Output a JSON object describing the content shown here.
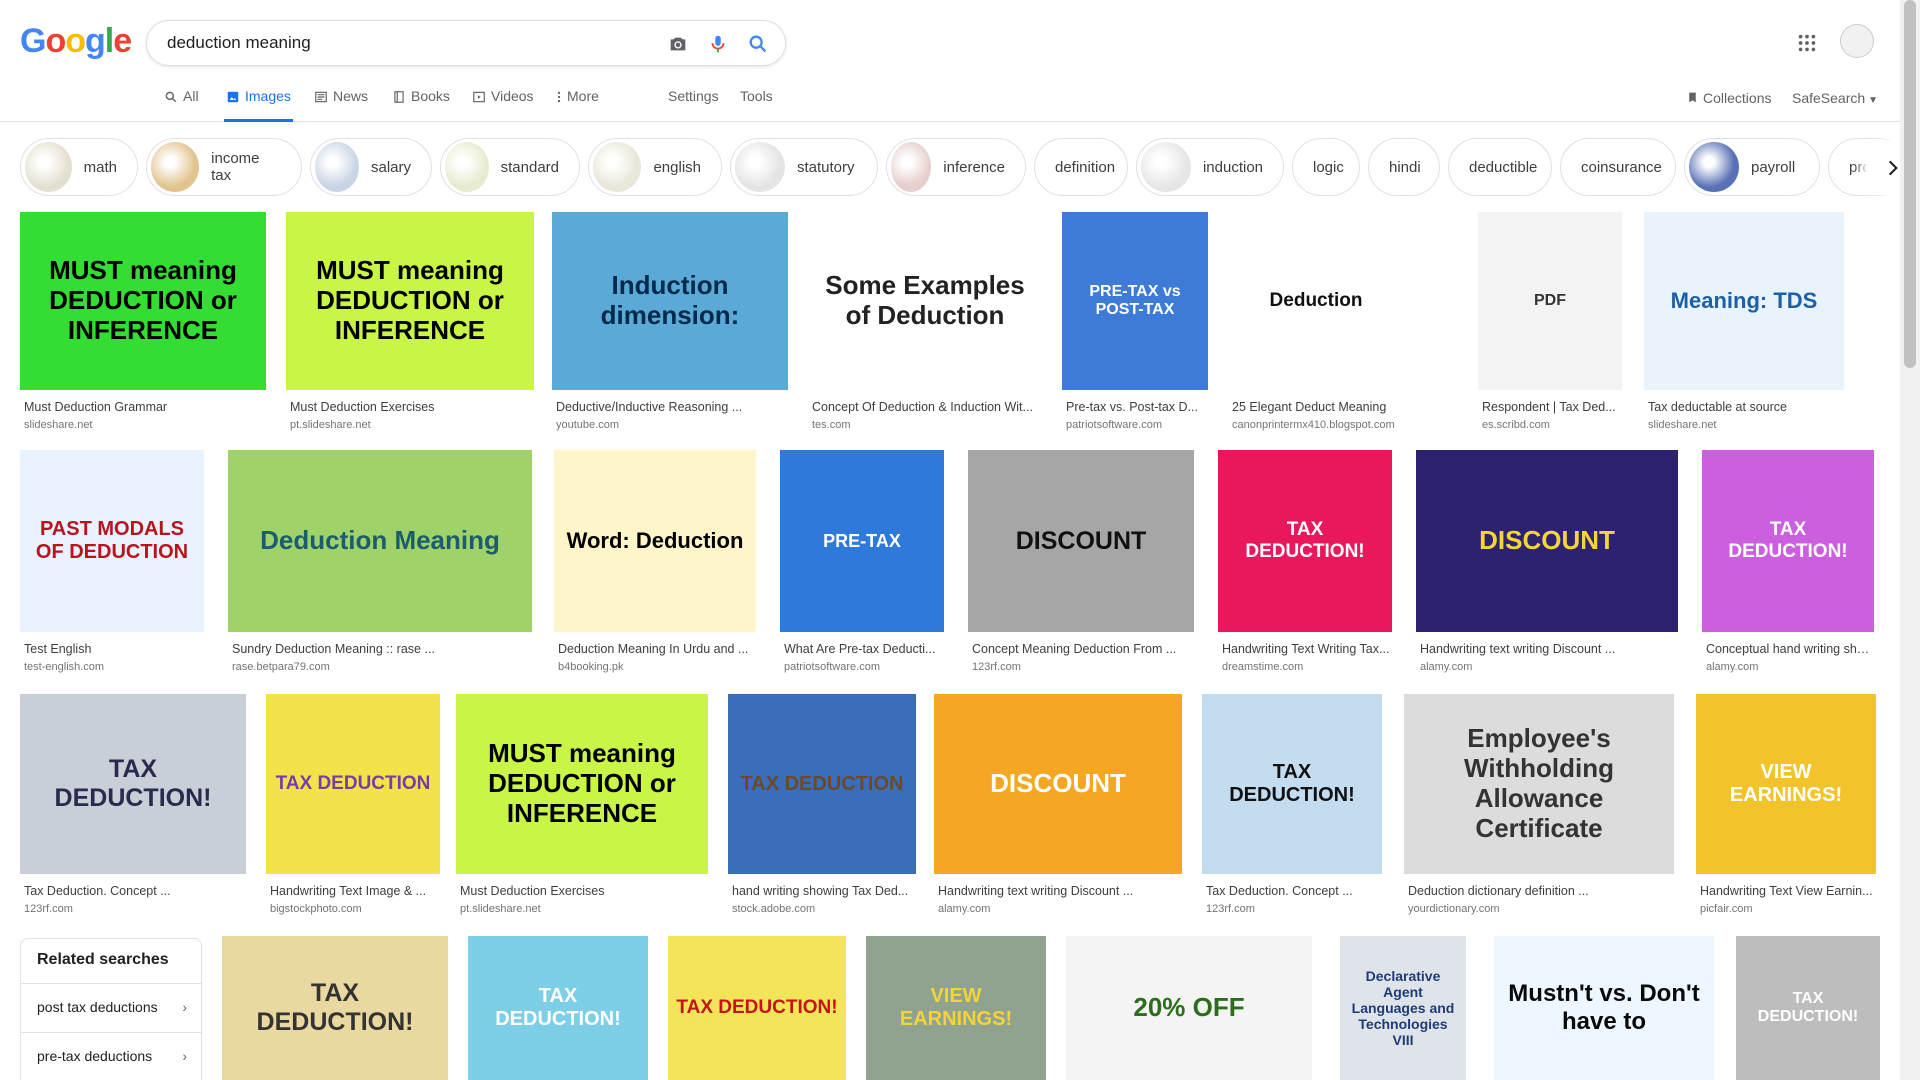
{
  "logo": {
    "letters": [
      "G",
      "o",
      "o",
      "g",
      "l",
      "e"
    ],
    "colors": [
      "#4285F4",
      "#EA4335",
      "#FBBC05",
      "#4285F4",
      "#34A853",
      "#EA4335"
    ]
  },
  "search": {
    "query": "deduction meaning"
  },
  "tabs": [
    {
      "label": "All",
      "icon": "search-icon",
      "active": false
    },
    {
      "label": "Images",
      "icon": "image-icon",
      "active": true
    },
    {
      "label": "News",
      "icon": "news-icon",
      "active": false
    },
    {
      "label": "Books",
      "icon": "book-icon",
      "active": false
    },
    {
      "label": "Videos",
      "icon": "video-icon",
      "active": false
    },
    {
      "label": "More",
      "icon": "more-icon",
      "active": false
    }
  ],
  "tools": {
    "settings": "Settings",
    "tools": "Tools",
    "collections": "Collections",
    "safesearch": "SafeSearch"
  },
  "chips": [
    {
      "label": "math"
    },
    {
      "label": "income tax"
    },
    {
      "label": "salary"
    },
    {
      "label": "standard"
    },
    {
      "label": "english"
    },
    {
      "label": "statutory"
    },
    {
      "label": "inference"
    },
    {
      "label": "definition"
    },
    {
      "label": "induction"
    },
    {
      "label": "logic"
    },
    {
      "label": "hindi"
    },
    {
      "label": "deductible"
    },
    {
      "label": "coinsurance"
    },
    {
      "label": "payroll"
    },
    {
      "label": "pro"
    }
  ],
  "results": [
    {
      "caption": "Must Deduction Grammar",
      "source": "slideshare.net",
      "text": "MUST meaning DEDUCTION or INFERENCE",
      "bg": "#33dd33",
      "fg": "#000000"
    },
    {
      "caption": "Must Deduction Exercises",
      "source": "pt.slideshare.net",
      "text": "MUST meaning DEDUCTION or INFERENCE",
      "bg": "#c8f546",
      "fg": "#000000"
    },
    {
      "caption": "Deductive/Inductive Reasoning ...",
      "source": "youtube.com",
      "text": "Induction dimension:",
      "bg": "#5aa9d6",
      "fg": "#002a4a"
    },
    {
      "caption": "Concept Of Deduction & Induction Wit...",
      "source": "tes.com",
      "text": "Some Examples of Deduction",
      "bg": "#ffffff",
      "fg": "#222222"
    },
    {
      "caption": "Pre-tax vs. Post-tax D...",
      "source": "patriotsoftware.com",
      "text": "PRE-TAX vs POST-TAX",
      "bg": "#3d7bd6",
      "fg": "#ffffff"
    },
    {
      "caption": "25 Elegant Deduct Meaning",
      "source": "canonprintermx410.blogspot.com",
      "text": "Deduction",
      "bg": "#ffffff",
      "fg": "#111111"
    },
    {
      "caption": "Respondent | Tax Ded...",
      "source": "es.scribd.com",
      "text": "PDF",
      "bg": "#f3f3f3",
      "fg": "#333333"
    },
    {
      "caption": "Tax deductable at source",
      "source": "slideshare.net",
      "text": "Meaning: TDS",
      "bg": "#e9f3fb",
      "fg": "#1d5fa8"
    },
    {
      "caption": "Test English",
      "source": "test-english.com",
      "text": "PAST MODALS OF DEDUCTION",
      "bg": "#e8f3ff",
      "fg": "#b8141e"
    },
    {
      "caption": "Sundry Deduction Meaning :: rase ...",
      "source": "rase.betpara79.com",
      "text": "Deduction Meaning",
      "bg": "#9fd36a",
      "fg": "#1b5c6e"
    },
    {
      "caption": "Deduction Meaning In Urdu and ...",
      "source": "b4booking.pk",
      "text": "Word: Deduction",
      "bg": "#fff5c8",
      "fg": "#000000"
    },
    {
      "caption": "What Are Pre-tax Deducti...",
      "source": "patriotsoftware.com",
      "text": "PRE-TAX",
      "bg": "#2f7ad9",
      "fg": "#ffffff"
    },
    {
      "caption": "Concept Meaning Deduction From ...",
      "source": "123rf.com",
      "text": "DISCOUNT",
      "bg": "#a6a6a6",
      "fg": "#111111"
    },
    {
      "caption": "Handwriting Text Writing Tax...",
      "source": "dreamstime.com",
      "text": "TAX DEDUCTION!",
      "bg": "#e8185a",
      "fg": "#ffffff"
    },
    {
      "caption": "Handwriting text writing Discount ...",
      "source": "alamy.com",
      "text": "DISCOUNT",
      "bg": "#2c2270",
      "fg": "#f5d33a"
    },
    {
      "caption": "Conceptual hand writing sho...",
      "source": "alamy.com",
      "text": "TAX DEDUCTION!",
      "bg": "#cc5fe0",
      "fg": "#ffffff"
    },
    {
      "caption": "Tax Deduction. Concept ...",
      "source": "123rf.com",
      "text": "TAX DEDUCTION!",
      "bg": "#c9cfd6",
      "fg": "#2a2a50"
    },
    {
      "caption": "Handwriting Text Image & ...",
      "source": "bigstockphoto.com",
      "text": "TAX DEDUCTION",
      "bg": "#f3e24a",
      "fg": "#7a3ea2"
    },
    {
      "caption": "Must Deduction Exercises",
      "source": "pt.slideshare.net",
      "text": "MUST meaning DEDUCTION or INFERENCE",
      "bg": "#c8f546",
      "fg": "#000000"
    },
    {
      "caption": "hand writing showing Tax Ded...",
      "source": "stock.adobe.com",
      "text": "TAX DEDUCTION",
      "bg": "#3a6dba",
      "fg": "#6b4a2a"
    },
    {
      "caption": "Handwriting text writing Discount ...",
      "source": "alamy.com",
      "text": "DISCOUNT",
      "bg": "#f5a623",
      "fg": "#ffffff"
    },
    {
      "caption": "Tax Deduction. Concept ...",
      "source": "123rf.com",
      "text": "TAX DEDUCTION!",
      "bg": "#c3dcef",
      "fg": "#111111"
    },
    {
      "caption": "Deduction dictionary definition ...",
      "source": "yourdictionary.com",
      "text": "Employee's Withholding Allowance Certificate",
      "bg": "#dcdcdc",
      "fg": "#333333"
    },
    {
      "caption": "Handwriting Text View Earnin...",
      "source": "picfair.com",
      "text": "VIEW EARNINGS!",
      "bg": "#f2c32a",
      "fg": "#ffffff"
    },
    {
      "caption": "",
      "source": "",
      "text": "TAX DEDUCTION!",
      "bg": "#e9d9a0",
      "fg": "#333333"
    },
    {
      "caption": "",
      "source": "",
      "text": "TAX DEDUCTION!",
      "bg": "#7dcfe8",
      "fg": "#ffffff"
    },
    {
      "caption": "",
      "source": "",
      "text": "TAX DEDUCTION!",
      "bg": "#f4e45a",
      "fg": "#c21616"
    },
    {
      "caption": "",
      "source": "",
      "text": "VIEW EARNINGS!",
      "bg": "#8fa38f",
      "fg": "#f5d33a"
    },
    {
      "caption": "",
      "source": "",
      "text": "20% OFF",
      "bg": "#f4f4f4",
      "fg": "#2a6e1a"
    },
    {
      "caption": "",
      "source": "",
      "text": "Declarative Agent Languages and Technologies VIII",
      "bg": "#dfe3ea",
      "fg": "#1d3c78"
    },
    {
      "caption": "",
      "source": "",
      "text": "Mustn't vs. Don't have to",
      "bg": "#eef7ff",
      "fg": "#0a0a0a"
    },
    {
      "caption": "",
      "source": "",
      "text": "TAX DEDUCTION!",
      "bg": "#bdbdbd",
      "fg": "#ffffff"
    }
  ],
  "related": {
    "title": "Related searches",
    "items": [
      {
        "label": "post tax deductions"
      },
      {
        "label": "pre-tax deductions"
      }
    ]
  }
}
